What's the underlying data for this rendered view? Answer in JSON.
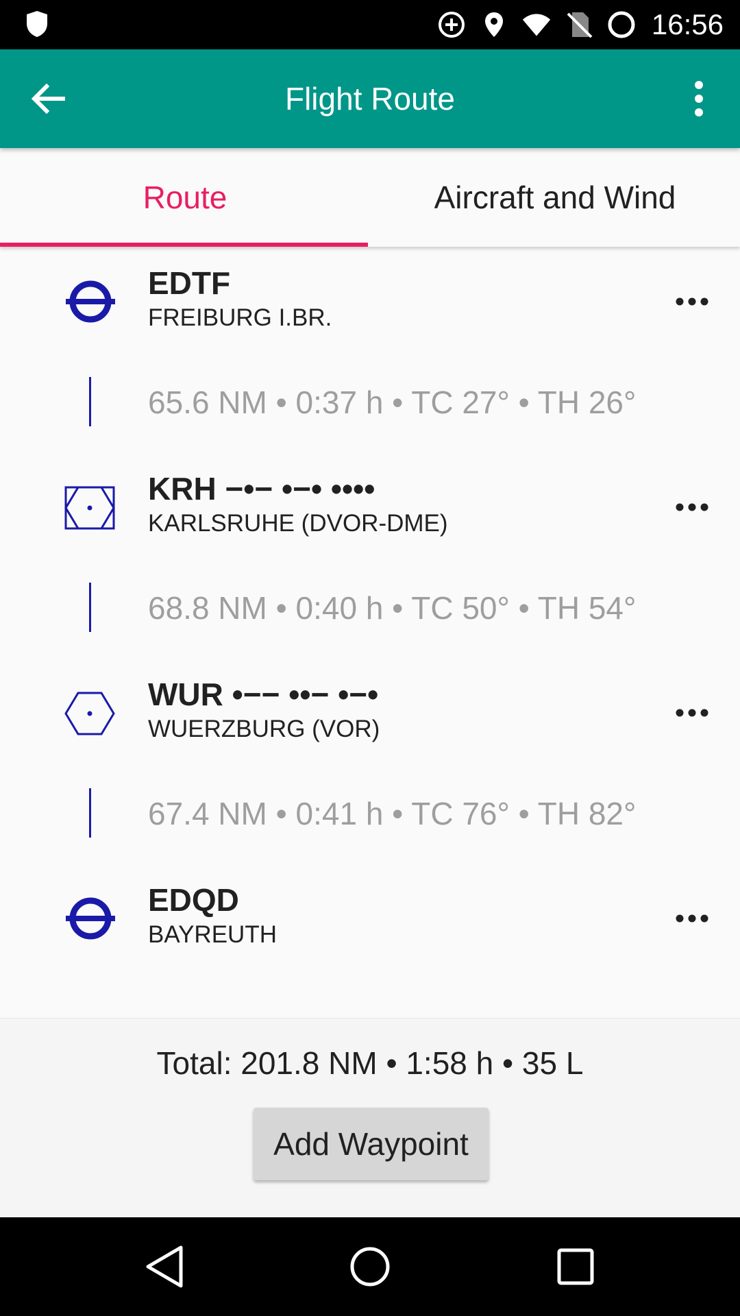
{
  "status_bar": {
    "time": "16:56",
    "icons": [
      "shield-icon",
      "data-saver-icon",
      "location-icon",
      "wifi-icon",
      "no-sim-icon",
      "battery-icon"
    ]
  },
  "app_bar": {
    "title": "Flight Route",
    "icons": [
      "back-arrow-icon",
      "more-vert-icon"
    ]
  },
  "tabs": [
    {
      "label": "Route",
      "active": true
    },
    {
      "label": "Aircraft and Wind",
      "active": false
    }
  ],
  "route": {
    "waypoints": [
      {
        "ident": "EDTF",
        "name": "FREIBURG I.BR.",
        "icon": "airfield-icon"
      },
      {
        "ident": "KRH −•− •−• ••••",
        "name": "KARLSRUHE (DVOR-DME)",
        "icon": "vor-dme-icon"
      },
      {
        "ident": "WUR •−− ••− •−•",
        "name": "WUERZBURG (VOR)",
        "icon": "vor-icon"
      },
      {
        "ident": "EDQD",
        "name": "BAYREUTH",
        "icon": "airfield-icon"
      }
    ],
    "legs": [
      {
        "text": "65.6 NM • 0:37 h • TC 27° • TH 26°"
      },
      {
        "text": "68.8 NM • 0:40 h • TC 50° • TH 54°"
      },
      {
        "text": "67.4 NM • 0:41 h • TC 76° • TH 82°"
      }
    ]
  },
  "summary": {
    "total": "Total: 201.8 NM • 1:58 h • 35 L",
    "add_button": "Add Waypoint"
  },
  "colors": {
    "app_bar": "#009688",
    "accent": "#e91e63",
    "symbol": "#1a1aa8"
  }
}
